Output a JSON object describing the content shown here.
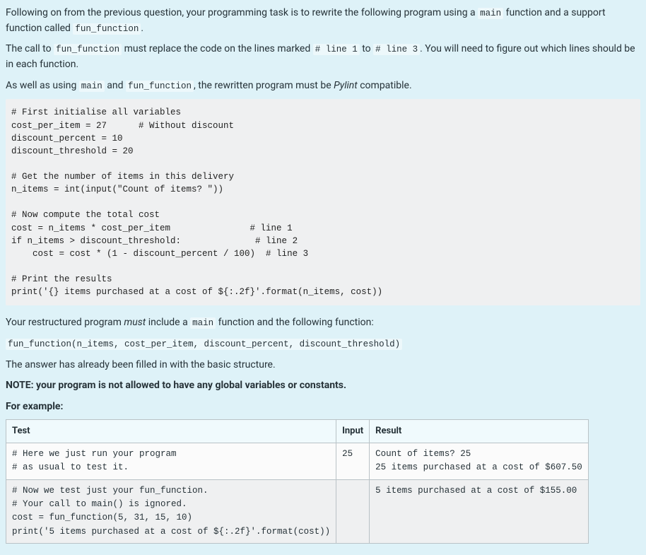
{
  "intro": {
    "p1_a": "Following on from the previous question, your programming task is to rewrite the following program using a ",
    "p1_main": "main",
    "p1_b": " function and a support function called ",
    "p1_fun": "fun_function",
    "p1_c": ".",
    "p2_a": "The call to ",
    "p2_fun": "fun_function",
    "p2_b": " must replace the code on the lines marked ",
    "p2_l1": "# line 1",
    "p2_c": " to ",
    "p2_l3": "# line 3",
    "p2_d": ".  You will need to figure out which lines should be in each function.",
    "p3_a": "As well as using ",
    "p3_main": "main",
    "p3_b": " and ",
    "p3_fun": "fun_function",
    "p3_c": ", the rewritten program must be ",
    "p3_pylint": "Pylint",
    "p3_d": " compatible."
  },
  "code": "# First initialise all variables\ncost_per_item = 27      # Without discount\ndiscount_percent = 10\ndiscount_threshold = 20\n\n# Get the number of items in this delivery\nn_items = int(input(\"Count of items? \"))\n\n# Now compute the total cost\ncost = n_items * cost_per_item               # line 1\nif n_items > discount_threshold:              # line 2\n    cost = cost * (1 - discount_percent / 100)  # line 3\n\n# Print the results\nprint('{} items purchased at a cost of ${:.2f}'.format(n_items, cost))",
  "mid": {
    "p4_a": "Your restructured program ",
    "p4_must": "must",
    "p4_b": " include a ",
    "p4_main": "main",
    "p4_c": " function and the following function:",
    "sig": "fun_function(n_items, cost_per_item, discount_percent, discount_threshold)",
    "p5": "The answer has already been filled in with the basic structure.",
    "note": "NOTE: your program is not allowed to have any global variables or constants.",
    "eg": "For example:"
  },
  "table": {
    "headers": {
      "test": "Test",
      "input": "Input",
      "result": "Result"
    },
    "rows": [
      {
        "test": "# Here we just run your program\n# as usual to test it.",
        "input": "25",
        "result": "Count of items? 25\n25 items purchased at a cost of $607.50"
      },
      {
        "test": "# Now we test just your fun_function.\n# Your call to main() is ignored.\ncost = fun_function(5, 31, 15, 10)\nprint('5 items purchased at a cost of ${:.2f}'.format(cost))",
        "input": "",
        "result": "5 items purchased at a cost of $155.00"
      }
    ]
  }
}
